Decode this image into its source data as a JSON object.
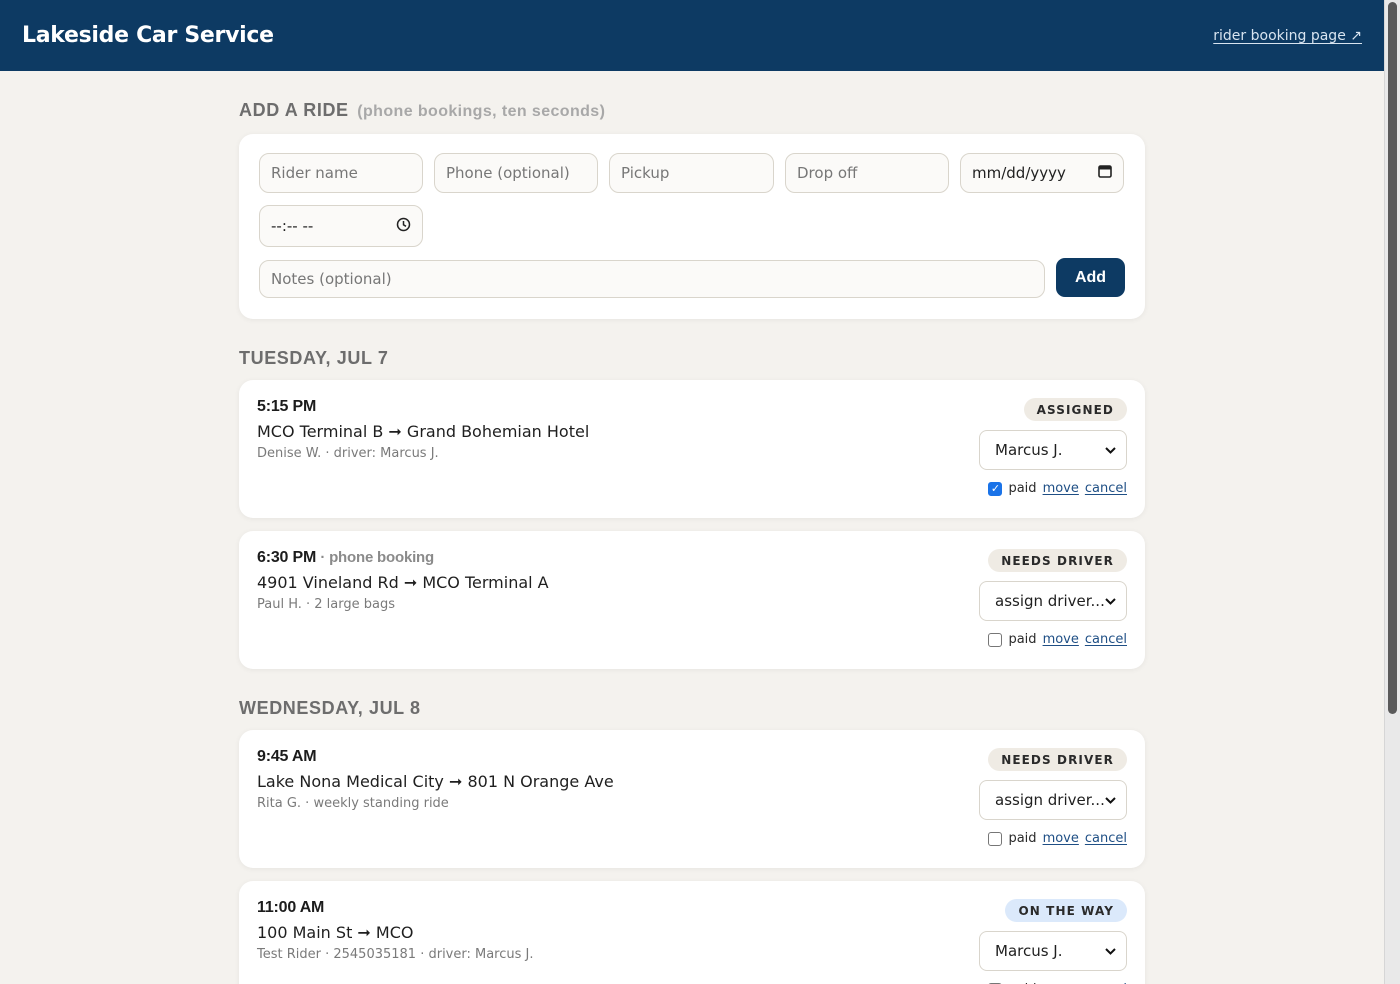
{
  "header": {
    "brand": "Lakeside Car Service",
    "rider_link": "rider booking page ↗"
  },
  "form": {
    "title": "ADD A RIDE",
    "subtitle": "(phone bookings, ten seconds)",
    "rider_name_placeholder": "Rider name",
    "phone_placeholder": "Phone (optional)",
    "pickup_placeholder": "Pickup",
    "dropoff_placeholder": "Drop off",
    "date_placeholder": "mm/dd/yyyy",
    "time_placeholder": "--:-- --",
    "notes_placeholder": "Notes (optional)",
    "add_label": "Add"
  },
  "days": [
    {
      "title": "TUESDAY, JUL 7",
      "rides": [
        {
          "time": "5:15 PM",
          "tag": "",
          "route": "MCO Terminal B ➞ Grand Bohemian Hotel",
          "meta": "Denise W. · driver: Marcus J.",
          "status": "ASSIGNED",
          "status_color": "neutral",
          "driver": "Marcus J.",
          "paid": true,
          "paid_label": "paid",
          "move_label": "move",
          "cancel_label": "cancel"
        },
        {
          "time": "6:30 PM",
          "tag": "· phone booking",
          "route": "4901 Vineland Rd ➞ MCO Terminal A",
          "meta": "Paul H. · 2 large bags",
          "status": "NEEDS DRIVER",
          "status_color": "neutral",
          "driver": "assign driver...",
          "paid": false,
          "paid_label": "paid",
          "move_label": "move",
          "cancel_label": "cancel"
        }
      ]
    },
    {
      "title": "WEDNESDAY, JUL 8",
      "rides": [
        {
          "time": "9:45 AM",
          "tag": "",
          "route": "Lake Nona Medical City ➞ 801 N Orange Ave",
          "meta": "Rita G. · weekly standing ride",
          "status": "NEEDS DRIVER",
          "status_color": "neutral",
          "driver": "assign driver...",
          "paid": false,
          "paid_label": "paid",
          "move_label": "move",
          "cancel_label": "cancel"
        },
        {
          "time": "11:00 AM",
          "tag": "",
          "route": "100 Main St ➞ MCO",
          "meta": "Test Rider · 2545035181 · driver: Marcus J.",
          "status": "ON THE WAY",
          "status_color": "blue",
          "driver": "Marcus J.",
          "paid": false,
          "paid_label": "paid",
          "move_label": "move",
          "cancel_label": "cancel"
        }
      ]
    }
  ],
  "colors": {
    "brand": "#0d3a63",
    "background": "#f4f2ee",
    "badge_neutral": "#efebe4",
    "badge_blue": "#dbe9fb"
  }
}
